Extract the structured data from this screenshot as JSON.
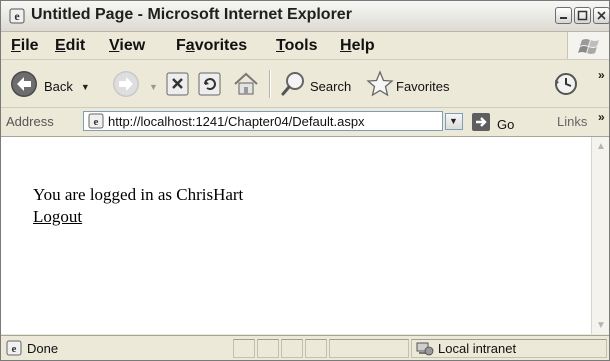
{
  "window": {
    "title": "Untitled Page - Microsoft Internet Explorer"
  },
  "menu": {
    "items": [
      {
        "label_accel": "F",
        "label_rest": "ile"
      },
      {
        "label_accel": "E",
        "label_rest": "dit"
      },
      {
        "label_accel": "V",
        "label_rest": "iew"
      },
      {
        "label_pre": "F",
        "label_accel": "a",
        "label_rest": "vorites"
      },
      {
        "label_accel": "T",
        "label_rest": "ools"
      },
      {
        "label_accel": "H",
        "label_rest": "elp"
      }
    ]
  },
  "toolbar": {
    "back_label": "Back",
    "search_label": "Search",
    "favorites_label": "Favorites",
    "overflow": "»"
  },
  "address": {
    "label": "Address",
    "url": "http://localhost:1241/Chapter04/Default.aspx",
    "go_label": "Go",
    "links_label": "Links",
    "links_overflow": "»"
  },
  "page": {
    "logged_in_text": "You are logged in as ChrisHart",
    "logout_link": "Logout"
  },
  "status": {
    "text": "Done",
    "zone": "Local intranet"
  },
  "colors": {
    "chrome": "#ece9d8",
    "back_green": "#2e9b2e",
    "go_green": "#2f8f2f"
  }
}
